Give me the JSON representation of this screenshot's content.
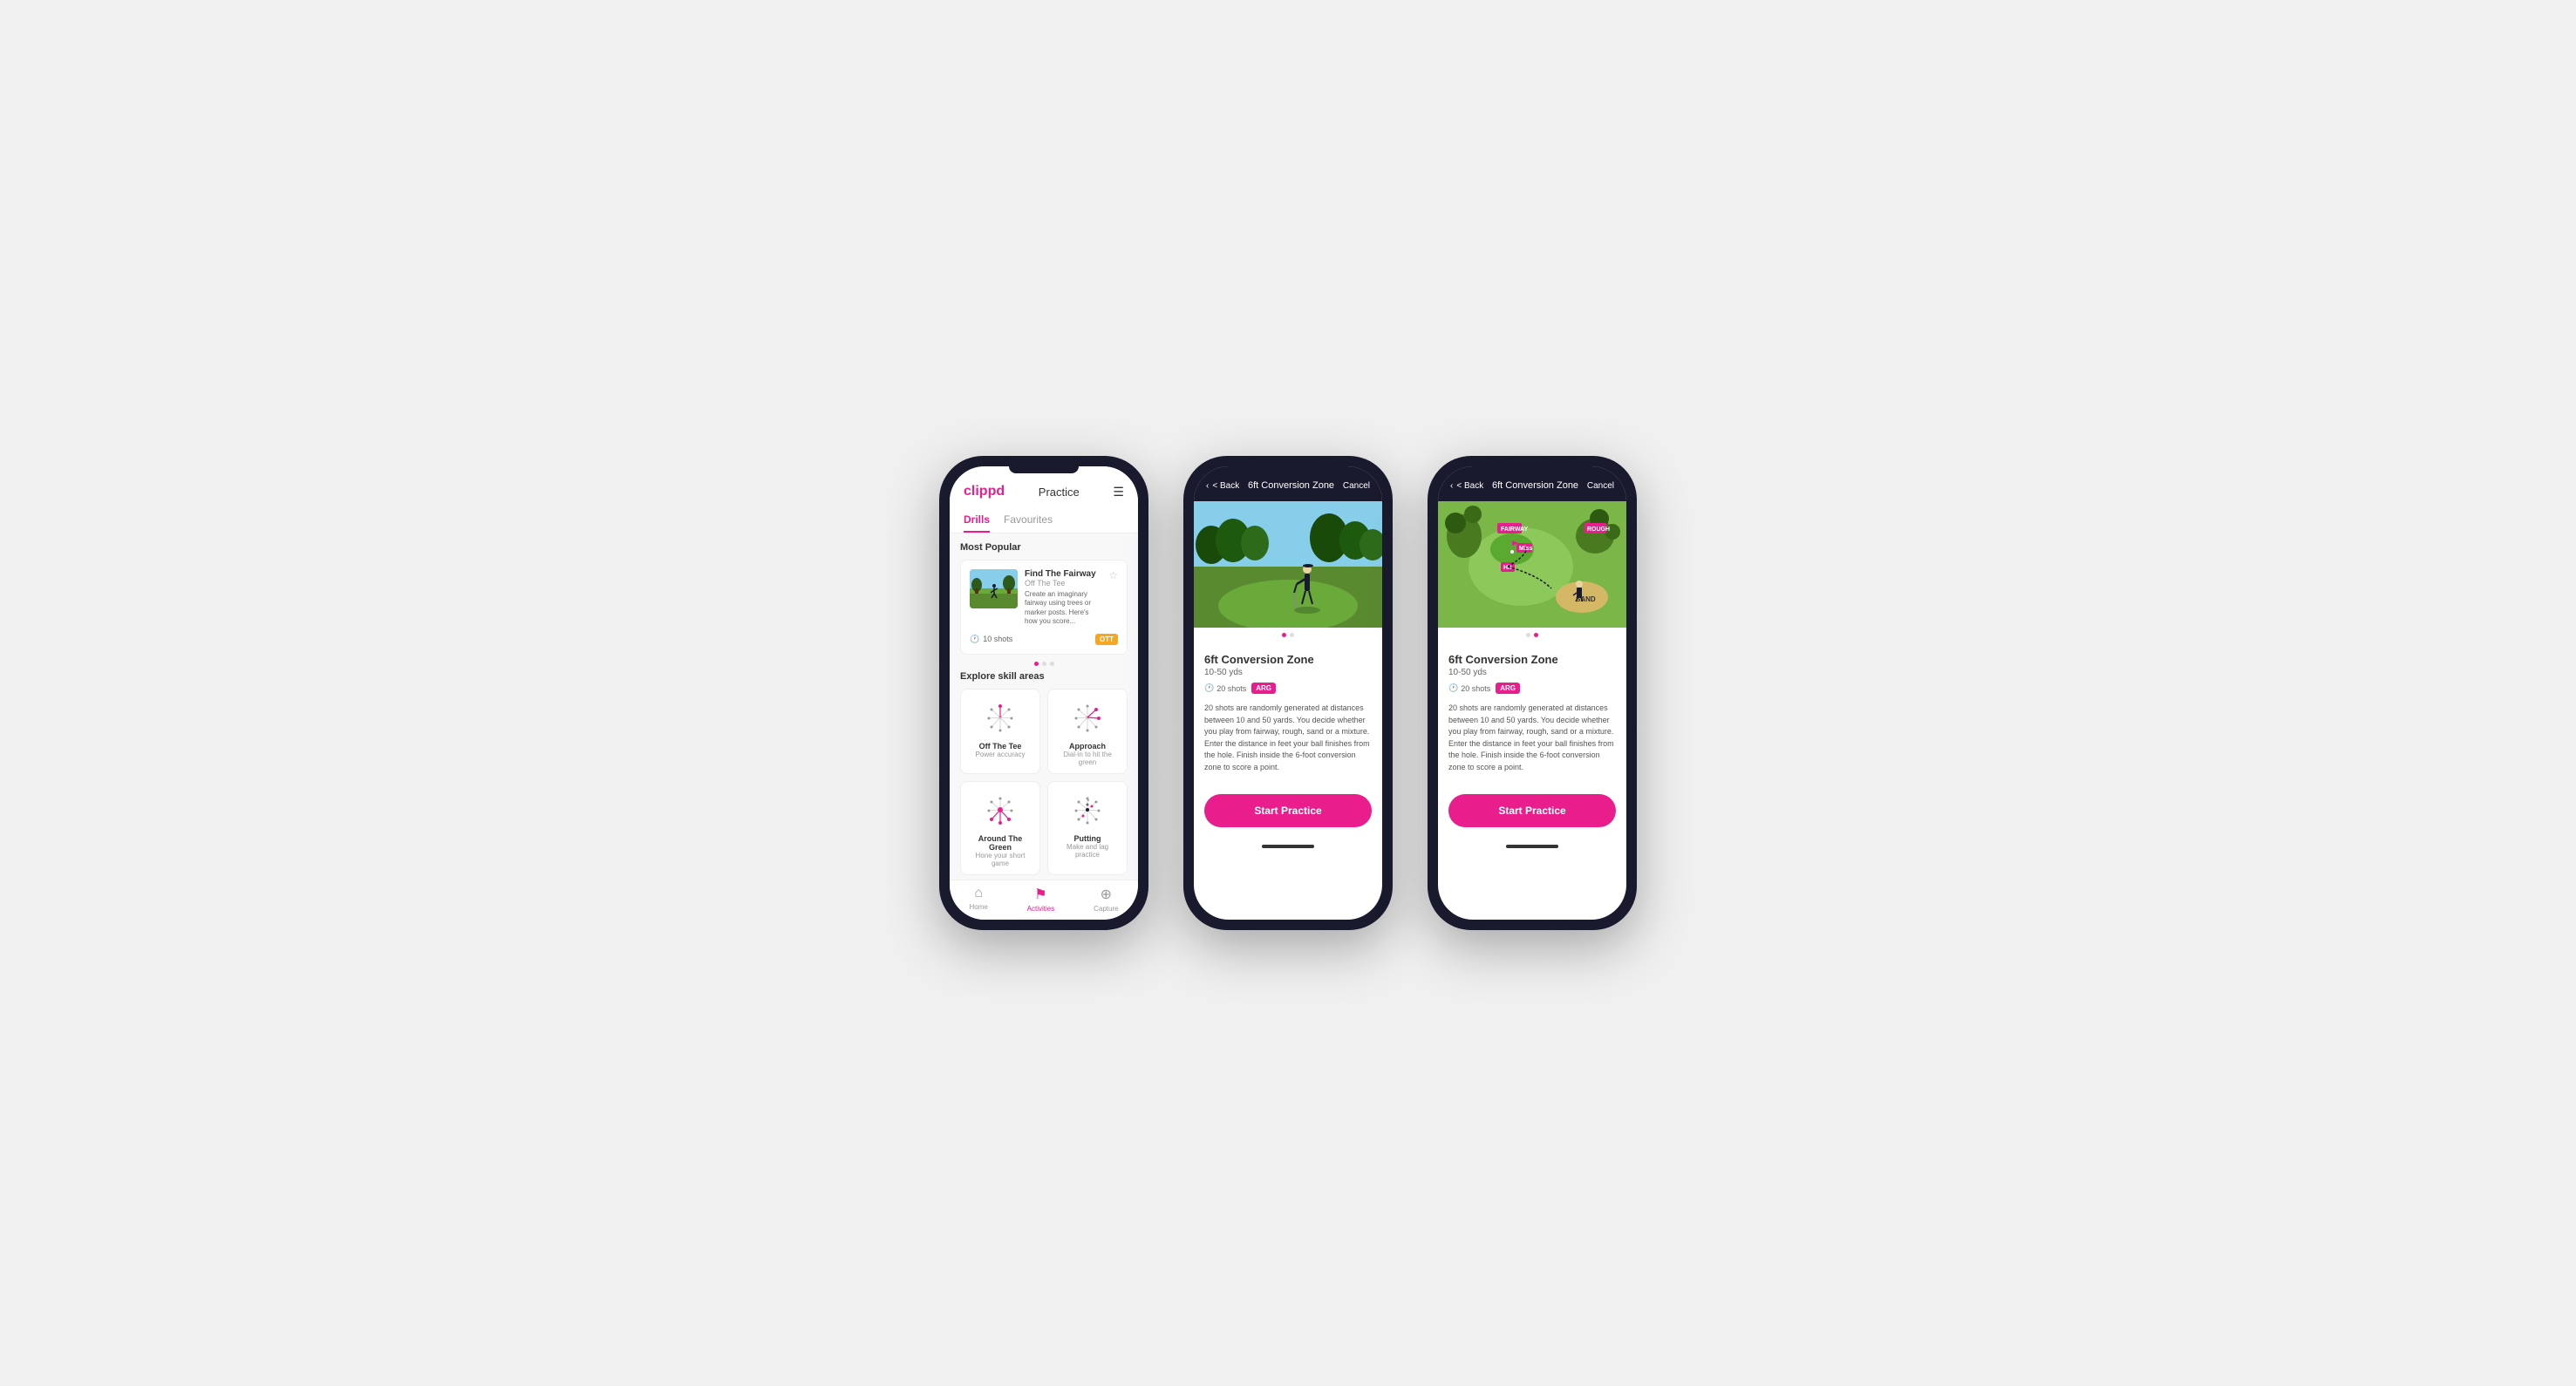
{
  "screens": {
    "screen1": {
      "header": {
        "logo": "clippd",
        "title": "Practice",
        "menu_icon": "☰"
      },
      "tabs": [
        {
          "label": "Drills",
          "active": true
        },
        {
          "label": "Favourites",
          "active": false
        }
      ],
      "most_popular": {
        "section_title": "Most Popular",
        "featured_drill": {
          "title": "Find The Fairway",
          "subtitle": "Off The Tee",
          "description": "Create an imaginary fairway using trees or marker posts. Here's how you score...",
          "shots": "10 shots",
          "tag": "OTT"
        }
      },
      "explore": {
        "section_title": "Explore skill areas",
        "skills": [
          {
            "name": "Off The Tee",
            "sub": "Power accuracy"
          },
          {
            "name": "Approach",
            "sub": "Dial-in to hit the green"
          },
          {
            "name": "Around The Green",
            "sub": "Hone your short game"
          },
          {
            "name": "Putting",
            "sub": "Make and lag practice"
          }
        ]
      },
      "bottom_nav": [
        {
          "label": "Home",
          "icon": "⌂",
          "active": false
        },
        {
          "label": "Activities",
          "icon": "♟",
          "active": true
        },
        {
          "label": "Capture",
          "icon": "⊕",
          "active": false
        }
      ]
    },
    "screen2": {
      "header": {
        "back_label": "< Back",
        "title": "6ft Conversion Zone",
        "cancel_label": "Cancel"
      },
      "drill": {
        "name": "6ft Conversion Zone",
        "range": "10-50 yds",
        "shots": "20 shots",
        "tag": "ARG",
        "description": "20 shots are randomly generated at distances between 10 and 50 yards. You decide whether you play from fairway, rough, sand or a mixture. Enter the distance in feet your ball finishes from the hole. Finish inside the 6-foot conversion zone to score a point.",
        "start_button": "Start Practice"
      }
    },
    "screen3": {
      "header": {
        "back_label": "< Back",
        "title": "6ft Conversion Zone",
        "cancel_label": "Cancel"
      },
      "drill": {
        "name": "6ft Conversion Zone",
        "range": "10-50 yds",
        "shots": "20 shots",
        "tag": "ARG",
        "description": "20 shots are randomly generated at distances between 10 and 50 yards. You decide whether you play from fairway, rough, sand or a mixture. Enter the distance in feet your ball finishes from the hole. Finish inside the 6-foot conversion zone to score a point.",
        "start_button": "Start Practice"
      }
    }
  }
}
